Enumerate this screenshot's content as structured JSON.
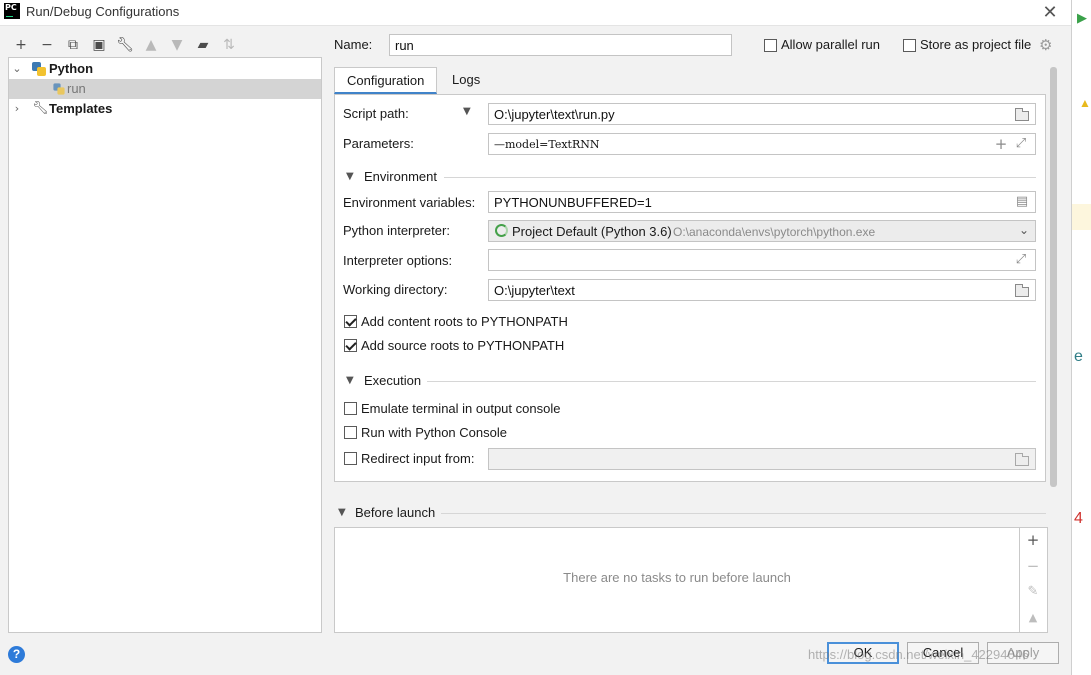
{
  "window": {
    "title": "Run/Debug Configurations",
    "app_icon_text": "PC"
  },
  "toolbar": {
    "icons": [
      "add-icon",
      "remove-icon",
      "copy-icon",
      "save-icon",
      "wrench-icon",
      "move-up-icon",
      "move-down-icon",
      "folder-add-icon",
      "sort-icon"
    ]
  },
  "tree": {
    "python_label": "Python",
    "run_label": "run",
    "templates_label": "Templates"
  },
  "header": {
    "name_label": "Name:",
    "name_value": "run",
    "allow_parallel_label": "Allow parallel run",
    "store_project_label": "Store as project file"
  },
  "tabs": {
    "configuration": "Configuration",
    "logs": "Logs"
  },
  "config": {
    "script_path_label": "Script path:",
    "script_path_value": "O:\\jupyter\\text\\run.py",
    "parameters_label": "Parameters:",
    "parameters_value": "—model=TextRNN",
    "environment_header": "Environment",
    "env_vars_label": "Environment variables:",
    "env_vars_value": "PYTHONUNBUFFERED=1",
    "interpreter_label": "Python interpreter:",
    "interpreter_name": "Project Default (Python 3.6)",
    "interpreter_path": "O:\\anaconda\\envs\\pytorch\\python.exe",
    "interp_options_label": "Interpreter options:",
    "interp_options_value": "",
    "working_dir_label": "Working directory:",
    "working_dir_value": "O:\\jupyter\\text",
    "add_content_roots": "Add content roots to PYTHONPATH",
    "add_source_roots": "Add source roots to PYTHONPATH",
    "execution_header": "Execution",
    "emulate_terminal": "Emulate terminal in output console",
    "run_with_console": "Run with Python Console",
    "redirect_input": "Redirect input from:"
  },
  "before_launch": {
    "header": "Before launch",
    "empty_text": "There are no tasks to run before launch"
  },
  "buttons": {
    "ok": "OK",
    "cancel": "Cancel",
    "apply": "Apply"
  },
  "watermark": "https://blog.csdn.net/weixin_42294046",
  "colors": {
    "accent": "#4083c9",
    "selection": "#d4d4d4"
  }
}
